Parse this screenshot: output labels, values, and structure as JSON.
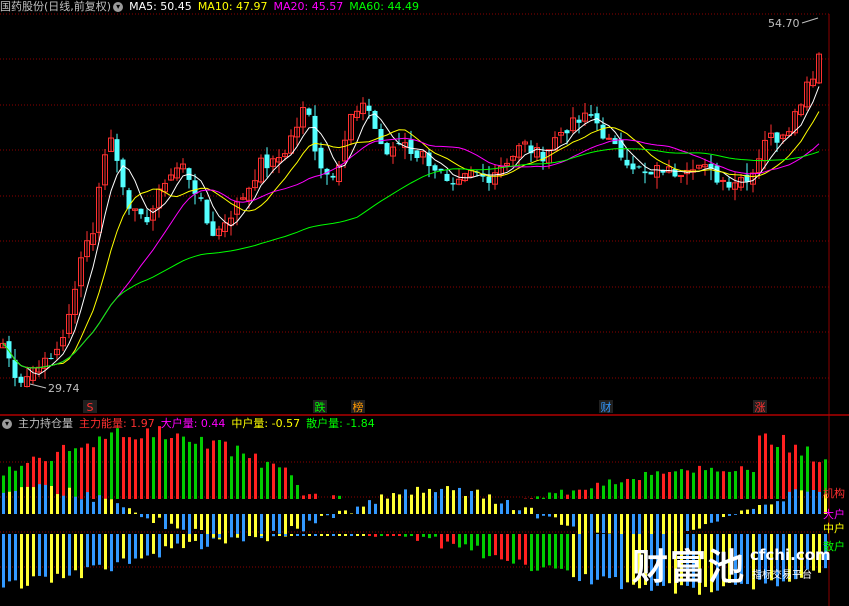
{
  "main_panel": {
    "title": "国药股份(日线,前复权)",
    "ma_labels": [
      {
        "label": "MA5: 50.45",
        "color": "#ffffff"
      },
      {
        "label": "MA10: 47.97",
        "color": "#ffff00"
      },
      {
        "label": "MA20: 45.57",
        "color": "#ff00ff"
      },
      {
        "label": "MA60: 44.49",
        "color": "#00ff00"
      }
    ],
    "high_label": "54.70",
    "low_label": "29.74",
    "markers": [
      {
        "text": "S",
        "color": "#ff3030"
      },
      {
        "text": "跌",
        "color": "#00ff00"
      },
      {
        "text": "榜",
        "color": "#ff9900"
      },
      {
        "text": "财",
        "color": "#3399ff"
      },
      {
        "text": "涨",
        "color": "#ff3030"
      }
    ]
  },
  "sub_panel": {
    "title": "主力持仓量",
    "values": [
      {
        "label": "主力能量: 1.97",
        "color": "#ff3030"
      },
      {
        "label": "大户量: 0.44",
        "color": "#ff00ff"
      },
      {
        "label": "中户量: -0.57",
        "color": "#ffff00"
      },
      {
        "label": "散户量: -1.84",
        "color": "#00ff00"
      }
    ],
    "right_labels": [
      {
        "text": "机构",
        "color": "#ff3030"
      },
      {
        "text": "大户",
        "color": "#ff00ff"
      },
      {
        "text": "中户",
        "color": "#ffff00"
      },
      {
        "text": "散户",
        "color": "#00ff00"
      }
    ]
  },
  "watermark": {
    "brand": "财富池",
    "site": "cfchi.com",
    "slogan": "指标交易平台"
  },
  "chart_data": {
    "type": "candlestick",
    "price_range": [
      29.74,
      54.7
    ],
    "series": [
      {
        "name": "MA5",
        "value": 50.45
      },
      {
        "name": "MA10",
        "value": 47.97
      },
      {
        "name": "MA20",
        "value": 45.57
      },
      {
        "name": "MA60",
        "value": 44.49
      }
    ]
  },
  "colors": {
    "up": "#ff3030",
    "down": "#54ffff",
    "grid": "#8b0000"
  }
}
